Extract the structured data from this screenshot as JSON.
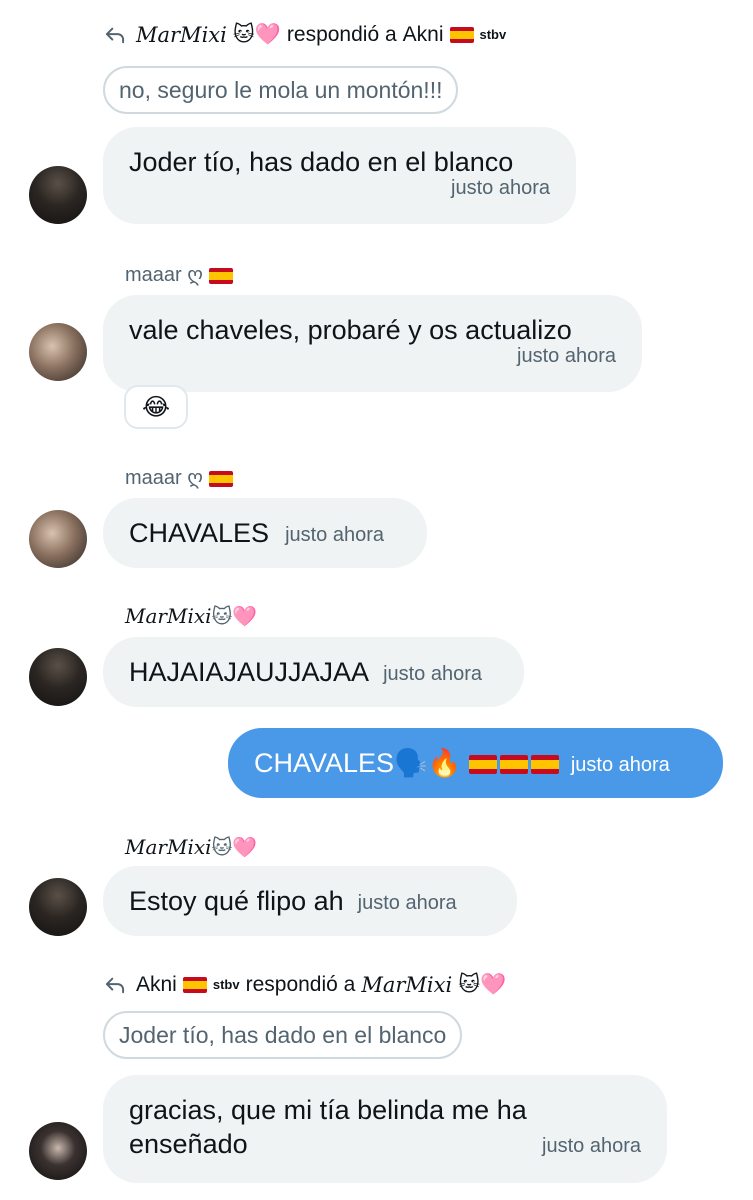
{
  "messages": [
    {
      "reply_header": {
        "author": "MarMixi",
        "author_emoji": "🐱🩷",
        "verb": "respondió a",
        "target": "Akni",
        "target_suffix": "stbv"
      },
      "quote": "no, seguro le mola un montón!!!",
      "text": "Joder tío, has dado en el blanco",
      "time": "justo ahora"
    },
    {
      "sender": "maaar ღ",
      "text": "vale chaveles, probaré y os actualizo",
      "time": "justo ahora",
      "reaction": "😂"
    },
    {
      "sender": "maaar ღ",
      "text": "CHAVALES",
      "time": "justo ahora"
    },
    {
      "sender": "MarMixi",
      "sender_emoji": "🐱🩷",
      "text": "HAJAIAJAUJJAJAA",
      "time": "justo ahora"
    },
    {
      "outgoing": true,
      "text": "CHAVALES",
      "text_emoji": "🗣️🔥",
      "time": "justo ahora"
    },
    {
      "sender": "MarMixi",
      "sender_emoji": "🐱🩷",
      "text": "Estoy qué flipo ah",
      "time": "justo ahora"
    },
    {
      "reply_header": {
        "author": "Akni",
        "author_suffix": "stbv",
        "verb": "respondió a",
        "target": "MarMixi",
        "target_emoji": "🐱🩷"
      },
      "quote": "Joder tío, has dado en el blanco",
      "text": "gracias, que mi tía belinda me ha enseñado",
      "time": "justo ahora"
    }
  ],
  "colors": {
    "incoming_bubble": "#eff3f4",
    "outgoing_bubble": "#4a99e9",
    "muted_text": "#536471",
    "primary_text": "#0f1419"
  }
}
